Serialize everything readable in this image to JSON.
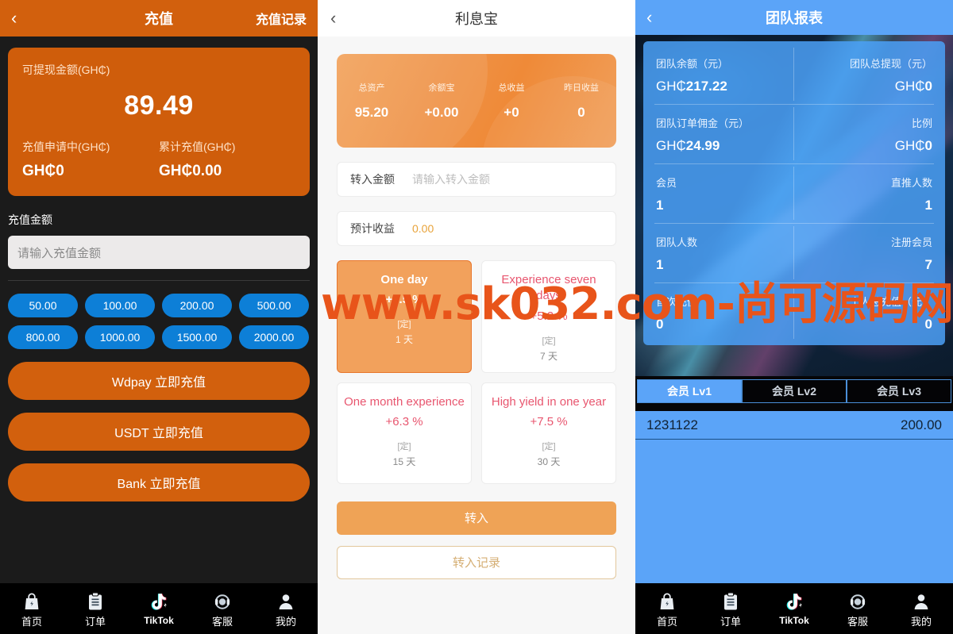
{
  "recharge": {
    "header": {
      "back_icon": "chevron-left-icon",
      "title": "充值",
      "records_link": "充值记录"
    },
    "balance_card": {
      "available_label": "可提现金额(GH₵)",
      "available_value": "89.49",
      "pending_label": "充值申请中(GH₵)",
      "pending_value": "GH₵0",
      "total_label": "累计充值(GH₵)",
      "total_value": "GH₵0.00"
    },
    "amount_section_title": "充值金额",
    "amount_input_placeholder": "请输入充值金额",
    "amount_input_value": "",
    "quick_amounts": [
      "50.00",
      "100.00",
      "200.00",
      "500.00",
      "800.00",
      "1000.00",
      "1500.00",
      "2000.00"
    ],
    "pay_buttons": [
      "Wdpay 立即充值",
      "USDT 立即充值",
      "Bank 立即充值"
    ]
  },
  "interest": {
    "header": {
      "back_icon": "chevron-left-icon",
      "title": "利息宝"
    },
    "summary": [
      {
        "label": "总资产",
        "value": "95.20"
      },
      {
        "label": "余额宝",
        "value": "+0.00"
      },
      {
        "label": "总收益",
        "value": "+0"
      },
      {
        "label": "昨日收益",
        "value": "0"
      }
    ],
    "transfer_amount": {
      "label": "转入金额",
      "placeholder": "请输入转入金额",
      "value": ""
    },
    "expected_profit": {
      "label": "预计收益",
      "value": "0.00"
    },
    "products": [
      {
        "name": "One day",
        "rate": "+3.5 %",
        "tag": "[定]",
        "duration": "1 天",
        "selected": true
      },
      {
        "name": "Experience seven days",
        "rate": "+5.2 %",
        "tag": "[定]",
        "duration": "7 天",
        "selected": false
      },
      {
        "name": "One month experience",
        "rate": "+6.3 %",
        "tag": "[定]",
        "duration": "15 天",
        "selected": false
      },
      {
        "name": "High yield in one year",
        "rate": "+7.5 %",
        "tag": "[定]",
        "duration": "30 天",
        "selected": false
      }
    ],
    "transfer_button": "转入",
    "records_button": "转入记录"
  },
  "team": {
    "header": {
      "back_icon": "chevron-left-icon",
      "title": "团队报表"
    },
    "stats": [
      [
        {
          "label": "团队余额（元）",
          "prefix": "GH₵",
          "value": "217.22"
        },
        {
          "label": "团队总提现（元）",
          "prefix": "GH₵",
          "value": "0"
        }
      ],
      [
        {
          "label": "团队订单佣金（元）",
          "prefix": "GH₵",
          "value": "24.99"
        },
        {
          "label": "比例",
          "prefix": "GH₵",
          "value": "0"
        }
      ],
      [
        {
          "label": "会员",
          "prefix": "",
          "value": "1"
        },
        {
          "label": "直推人数",
          "prefix": "",
          "value": "1"
        }
      ],
      [
        {
          "label": "团队人数",
          "prefix": "",
          "value": "1"
        },
        {
          "label": "注册会员",
          "prefix": "",
          "value": "7"
        }
      ],
      [
        {
          "label": "首次充值",
          "prefix": "",
          "value": "0"
        },
        {
          "label": "个人总充值（元）",
          "prefix": "",
          "value": "0"
        }
      ]
    ],
    "tabs": [
      {
        "label": "会员 Lv1",
        "active": true
      },
      {
        "label": "会员 Lv2",
        "active": false
      },
      {
        "label": "会员 Lv3",
        "active": false
      }
    ],
    "rows": [
      {
        "name": "1231122",
        "amount": "200.00"
      }
    ]
  },
  "tabbar": [
    {
      "icon": "bag-home-icon",
      "label": "首页"
    },
    {
      "icon": "clipboard-order-icon",
      "label": "订单"
    },
    {
      "icon": "tiktok-icon",
      "label": "TikTok"
    },
    {
      "icon": "headset-support-icon",
      "label": "客服"
    },
    {
      "icon": "person-profile-icon",
      "label": "我的"
    }
  ],
  "watermark": {
    "text": "www.sk032.com-尚可源码网",
    "color": "#e8541a"
  },
  "colors": {
    "recharge_orange": "#d2600d",
    "quick_blue": "#0d7fd7",
    "dark_bg": "#1b1b1b",
    "interest_orange": "#efa356",
    "product_pink": "#e8566f",
    "team_blue": "#5ba4f8"
  }
}
